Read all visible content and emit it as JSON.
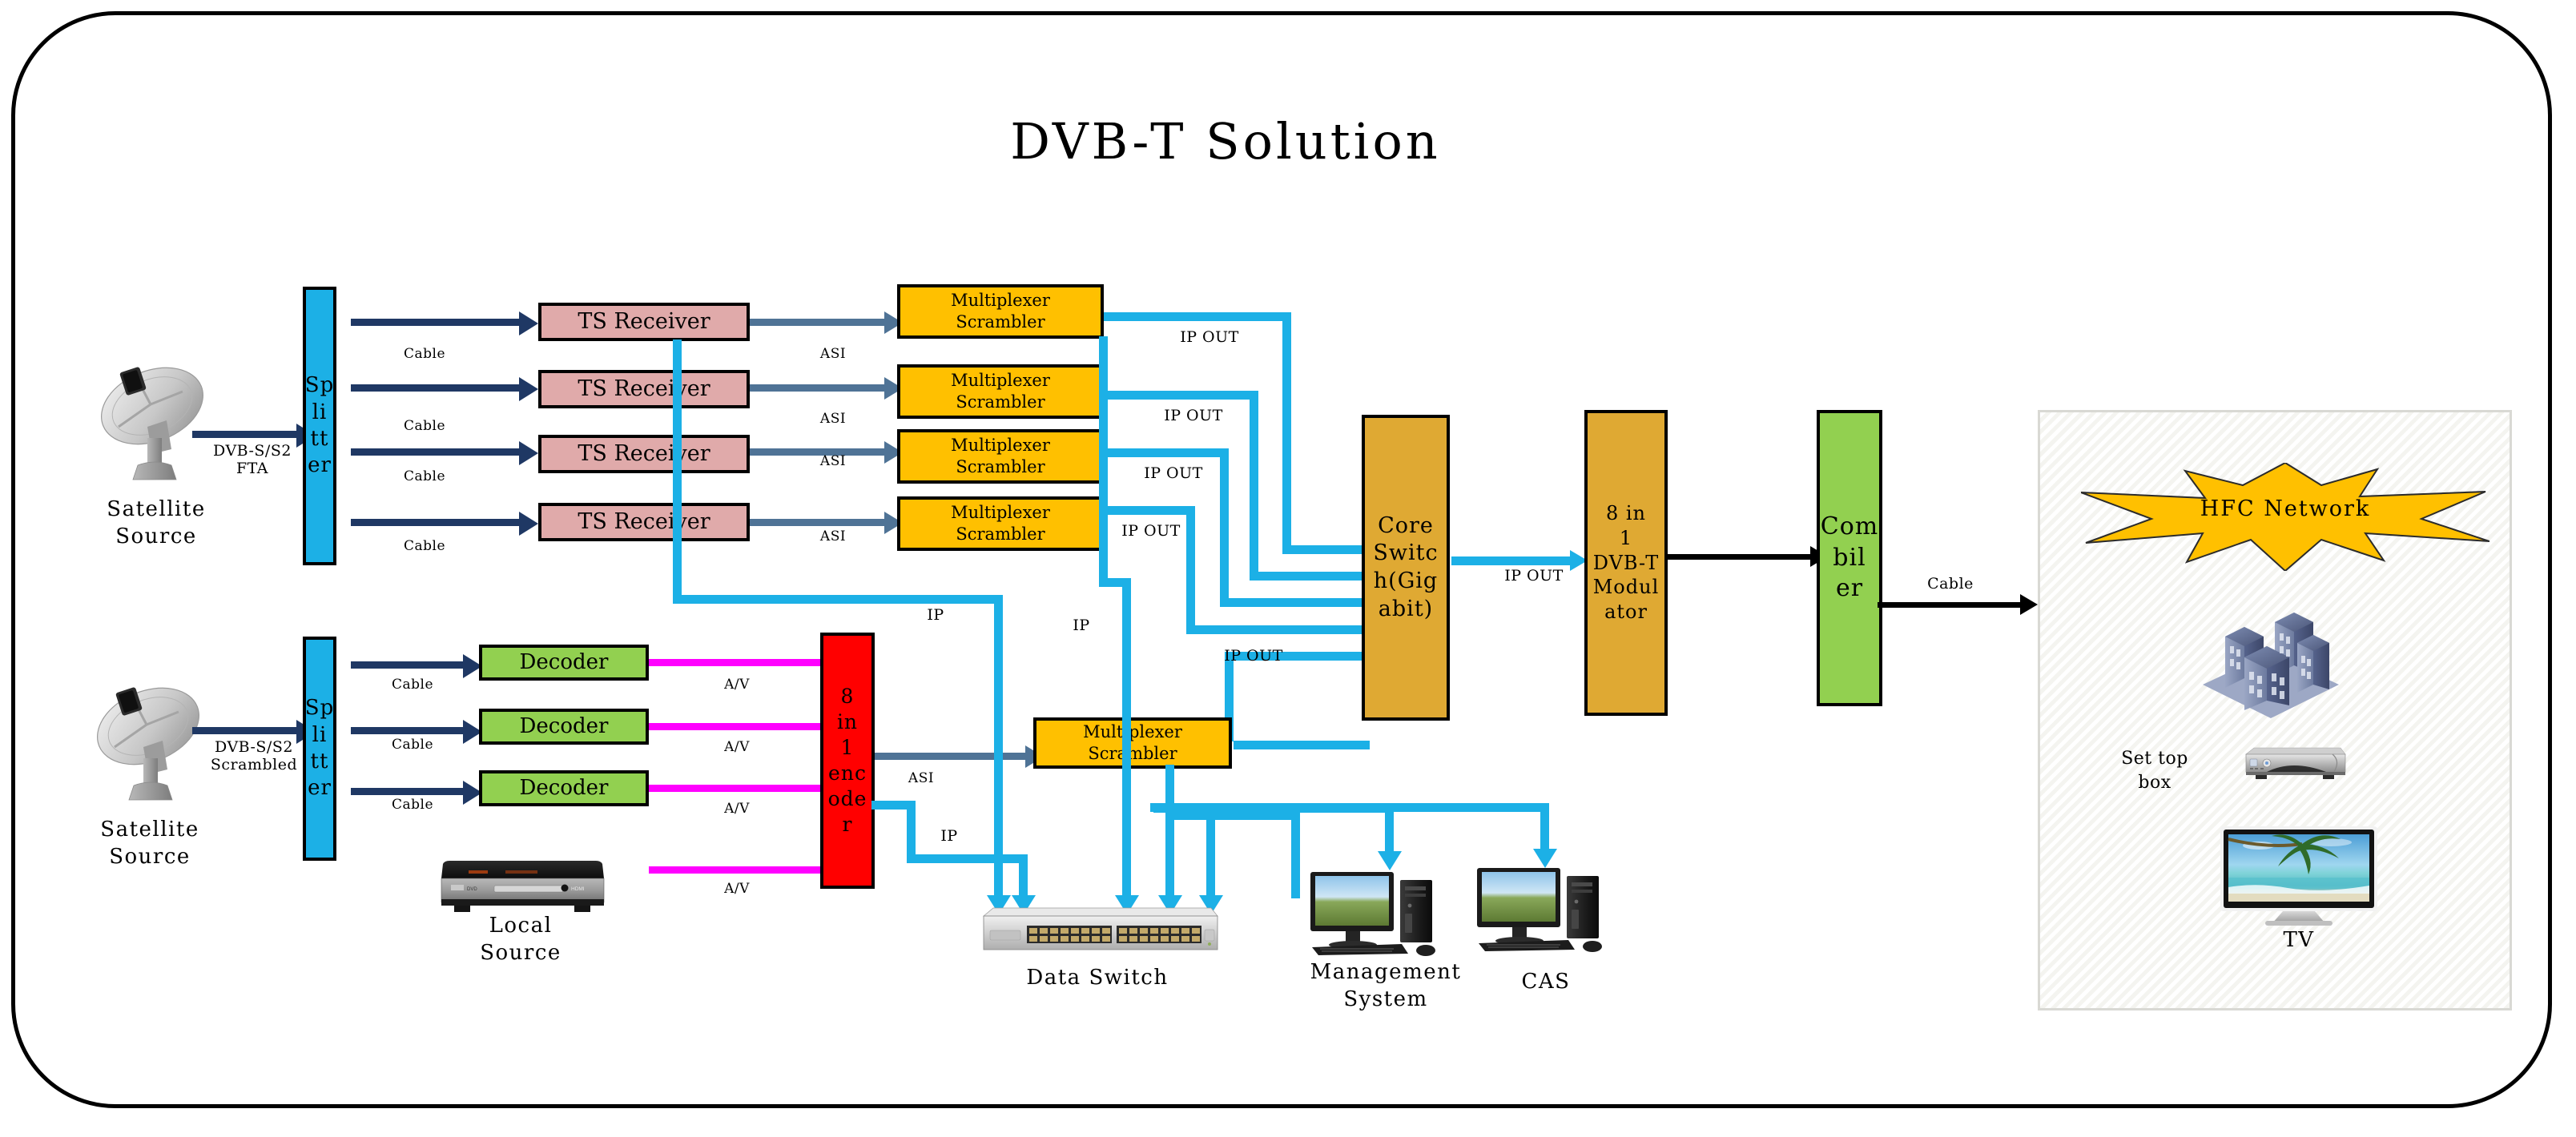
{
  "diagram": {
    "title": "DVB-T Solution",
    "frame_shape": "rounded-rectangle"
  },
  "colors": {
    "splitter": "#1cb0e6",
    "ts_receiver": "#e0aaaa",
    "multiplexer": "#ffc000",
    "core_switch": "#dfa933",
    "modulator": "#dfa933",
    "combiner": "#92d050",
    "decoder": "#92d050",
    "encoder": "#ff0000",
    "hfc_star": "#ffc000",
    "ip_link": "#1cb0e6",
    "cable_link": "#1f3864",
    "asi_link": "#4f7396",
    "av_link": "#ff00ff",
    "rf_link": "#000000"
  },
  "sources": [
    {
      "id": "satellite-fta",
      "icon": "satellite-dish-icon",
      "label_line1": "Satellite",
      "label_line2": "Source",
      "link_label_line1": "DVB-S/S2",
      "link_label_line2": "FTA"
    },
    {
      "id": "satellite-scrambled",
      "icon": "satellite-dish-icon",
      "label_line1": "Satellite",
      "label_line2": "Source",
      "link_label_line1": "DVB-S/S2",
      "link_label_line2": "Scrambled"
    }
  ],
  "local_source": {
    "icon": "dvd-player-icon",
    "label_line1": "Local",
    "label_line2": "Source",
    "link_label": "A/V"
  },
  "splitters": [
    {
      "id": "splitter-top",
      "label_chars": [
        "Sp",
        "li",
        "tt",
        "er"
      ]
    },
    {
      "id": "splitter-bottom",
      "label_chars": [
        "Sp",
        "li",
        "tt",
        "er"
      ]
    }
  ],
  "ts_receivers": [
    {
      "label": "TS Receiver",
      "in_label": "Cable",
      "out_label": "ASI"
    },
    {
      "label": "TS Receiver",
      "in_label": "Cable",
      "out_label": "ASI"
    },
    {
      "label": "TS Receiver",
      "in_label": "Cable",
      "out_label": "ASI"
    },
    {
      "label": "TS Receiver",
      "in_label": "Cable",
      "out_label": "ASI"
    }
  ],
  "decoders": [
    {
      "label": "Decoder",
      "in_label": "Cable",
      "out_label": "A/V"
    },
    {
      "label": "Decoder",
      "in_label": "Cable",
      "out_label": "A/V"
    },
    {
      "label": "Decoder",
      "in_label": "Cable",
      "out_label": "A/V"
    }
  ],
  "multiplexers": [
    {
      "line1": "Multiplexer",
      "line2": "Scrambler",
      "out_label": "IP OUT"
    },
    {
      "line1": "Multiplexer",
      "line2": "Scrambler",
      "out_label": "IP OUT"
    },
    {
      "line1": "Multiplexer",
      "line2": "Scrambler",
      "out_label": "IP OUT"
    },
    {
      "line1": "Multiplexer",
      "line2": "Scrambler",
      "out_label": "IP OUT"
    },
    {
      "line1": "Multiplexer",
      "line2": "Scrambler",
      "out_label": "IP OUT"
    }
  ],
  "encoder": {
    "label_chars": [
      "8",
      "in",
      "1",
      "enc",
      "ode",
      "r"
    ],
    "in_label": "A/V",
    "out_label_asi": "ASI",
    "out_label_ip": "IP"
  },
  "core_switch": {
    "label_chars": [
      "Core",
      "Switc",
      "h(Gig",
      "abit)"
    ],
    "out_label": "IP OUT"
  },
  "modulator": {
    "label_chars": [
      "8 in",
      "1",
      "DVB-T",
      "Modul",
      "ator"
    ]
  },
  "combiner": {
    "label_chars": [
      "Com",
      "bil",
      "er"
    ],
    "out_label": "Cable"
  },
  "data_switch": {
    "icon": "rack-switch-icon",
    "label": "Data Switch",
    "link_label": "IP"
  },
  "management_system": {
    "icon": "desktop-computer-icon",
    "label_line1": "Management",
    "label_line2": "System"
  },
  "cas": {
    "icon": "desktop-computer-icon",
    "label": "CAS"
  },
  "hfc": {
    "star_label": "HFC Network",
    "buildings_icon": "apartment-buildings-icon",
    "set_top_box": {
      "icon": "set-top-box-icon",
      "label_line1": "Set top",
      "label_line2": "box"
    },
    "tv": {
      "icon": "television-icon",
      "label": "TV"
    }
  },
  "ip_labels": {
    "ip": "IP",
    "ip_out": "IP OUT",
    "asi": "ASI",
    "av": "A/V",
    "cable": "Cable"
  }
}
